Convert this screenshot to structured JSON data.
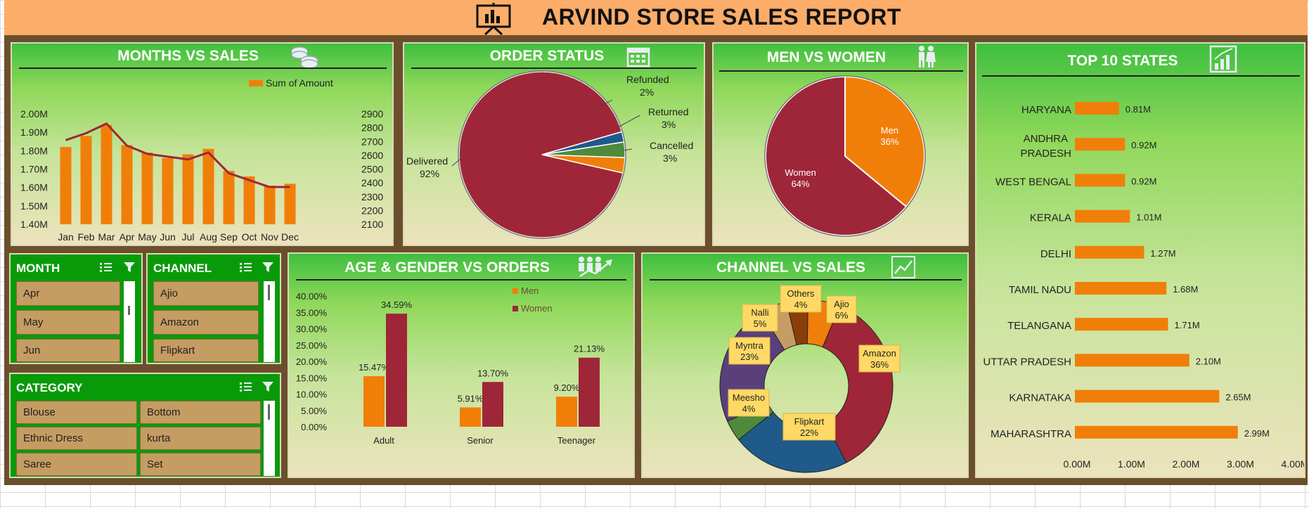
{
  "header": {
    "title": "ARVIND STORE SALES REPORT"
  },
  "colors": {
    "orange": "#f07f09",
    "maroon": "#9e2638",
    "header": "#fbad69",
    "slicer_green": "#099a09"
  },
  "panels": {
    "months": {
      "title": "MONTHS VS SALES",
      "legend": "Sum of Amount"
    },
    "order_status": {
      "title": "ORDER STATUS"
    },
    "men_women": {
      "title": "MEN VS WOMEN"
    },
    "top_states": {
      "title": "TOP 10 STATES"
    },
    "age_gender": {
      "title": "AGE & GENDER  VS ORDERS"
    },
    "channel": {
      "title": "CHANNEL VS SALES"
    }
  },
  "slicers": {
    "month": {
      "title": "MONTH",
      "items": [
        "Apr",
        "May",
        "Jun"
      ]
    },
    "channel": {
      "title": "CHANNEL",
      "items": [
        "Ajio",
        "Amazon",
        "Flipkart"
      ]
    },
    "category": {
      "title": "CATEGORY",
      "items": [
        "Blouse",
        "Bottom",
        "Ethnic Dress",
        "kurta",
        "Saree",
        "Set"
      ]
    }
  },
  "chart_data": [
    {
      "id": "months",
      "type": "bar",
      "categories": [
        "Jan",
        "Feb",
        "Mar",
        "Apr",
        "May",
        "Jun",
        "Jul",
        "Aug",
        "Sep",
        "Oct",
        "Nov",
        "Dec"
      ],
      "series": [
        {
          "name": "Sum of Amount",
          "type": "bar",
          "axis": "left",
          "values": [
            1.82,
            1.88,
            1.94,
            1.83,
            1.79,
            1.76,
            1.78,
            1.81,
            1.69,
            1.66,
            1.61,
            1.62
          ]
        },
        {
          "type": "line",
          "axis": "right",
          "values": [
            2710,
            2760,
            2830,
            2670,
            2610,
            2590,
            2570,
            2620,
            2470,
            2420,
            2370,
            2370
          ]
        }
      ],
      "yticks_left": [
        "2.00M",
        "1.90M",
        "1.80M",
        "1.70M",
        "1.60M",
        "1.50M",
        "1.40M"
      ],
      "yticks_right": [
        "2900",
        "2800",
        "2700",
        "2600",
        "2500",
        "2400",
        "2300",
        "2200",
        "2100"
      ],
      "ylim_left": [
        1.4,
        2.0
      ],
      "ylim_right": [
        2100,
        2900
      ]
    },
    {
      "id": "order_status",
      "type": "pie",
      "slices": [
        {
          "label": "Delivered",
          "pct": "92%",
          "value": 92,
          "color": "#9e2638"
        },
        {
          "label": "Refunded",
          "pct": "2%",
          "value": 2,
          "color": "#1f5a8a"
        },
        {
          "label": "Returned",
          "pct": "3%",
          "value": 3,
          "color": "#4f8a3c"
        },
        {
          "label": "Cancelled",
          "pct": "3%",
          "value": 3,
          "color": "#f07f09"
        }
      ]
    },
    {
      "id": "men_women",
      "type": "pie",
      "slices": [
        {
          "label": "Men",
          "pct": "36%",
          "value": 36,
          "color": "#f07f09"
        },
        {
          "label": "Women",
          "pct": "64%",
          "value": 64,
          "color": "#9e2638"
        }
      ]
    },
    {
      "id": "top_states",
      "type": "bar",
      "orientation": "horizontal",
      "categories": [
        "HARYANA",
        "ANDHRA PRADESH",
        "WEST BENGAL",
        "KERALA",
        "DELHI",
        "TAMIL NADU",
        "TELANGANA",
        "UTTAR PRADESH",
        "KARNATAKA",
        "MAHARASHTRA"
      ],
      "values": [
        0.81,
        0.92,
        0.92,
        1.01,
        1.27,
        1.68,
        1.71,
        2.1,
        2.65,
        2.99
      ],
      "data_labels": [
        "0.81M",
        "0.92M",
        "0.92M",
        "1.01M",
        "1.27M",
        "1.68M",
        "1.71M",
        "2.10M",
        "2.65M",
        "2.99M"
      ],
      "xticks": [
        "0.00M",
        "1.00M",
        "2.00M",
        "3.00M",
        "4.00M"
      ],
      "xlim": [
        0,
        4
      ]
    },
    {
      "id": "age_gender",
      "type": "bar",
      "categories": [
        "Adult",
        "Senior",
        "Teenager"
      ],
      "series": [
        {
          "name": "Men",
          "color": "#f07f09",
          "values": [
            15.47,
            5.91,
            9.2
          ],
          "labels": [
            "15.47%",
            "5.91%",
            "9.20%"
          ]
        },
        {
          "name": "Women",
          "color": "#9e2638",
          "values": [
            34.59,
            13.7,
            21.13
          ],
          "labels": [
            "34.59%",
            "13.70%",
            "21.13%"
          ]
        }
      ],
      "yticks": [
        "40.00%",
        "35.00%",
        "30.00%",
        "25.00%",
        "20.00%",
        "15.00%",
        "10.00%",
        "5.00%",
        "0.00%"
      ],
      "ylim": [
        0,
        40
      ]
    },
    {
      "id": "channel",
      "type": "pie",
      "donut": true,
      "slices": [
        {
          "label": "Ajio",
          "pct": "6%",
          "value": 6,
          "color": "#f07f09"
        },
        {
          "label": "Amazon",
          "pct": "36%",
          "value": 36,
          "color": "#9e2638"
        },
        {
          "label": "Flipkart",
          "pct": "22%",
          "value": 22,
          "color": "#1f5a8a"
        },
        {
          "label": "Meesho",
          "pct": "4%",
          "value": 4,
          "color": "#4f8a3c"
        },
        {
          "label": "Myntra",
          "pct": "23%",
          "value": 23,
          "color": "#5a3f7a"
        },
        {
          "label": "Nalli",
          "pct": "5%",
          "value": 5,
          "color": "#c59c62"
        },
        {
          "label": "Others",
          "pct": "4%",
          "value": 4,
          "color": "#8a3f0a"
        }
      ]
    }
  ]
}
